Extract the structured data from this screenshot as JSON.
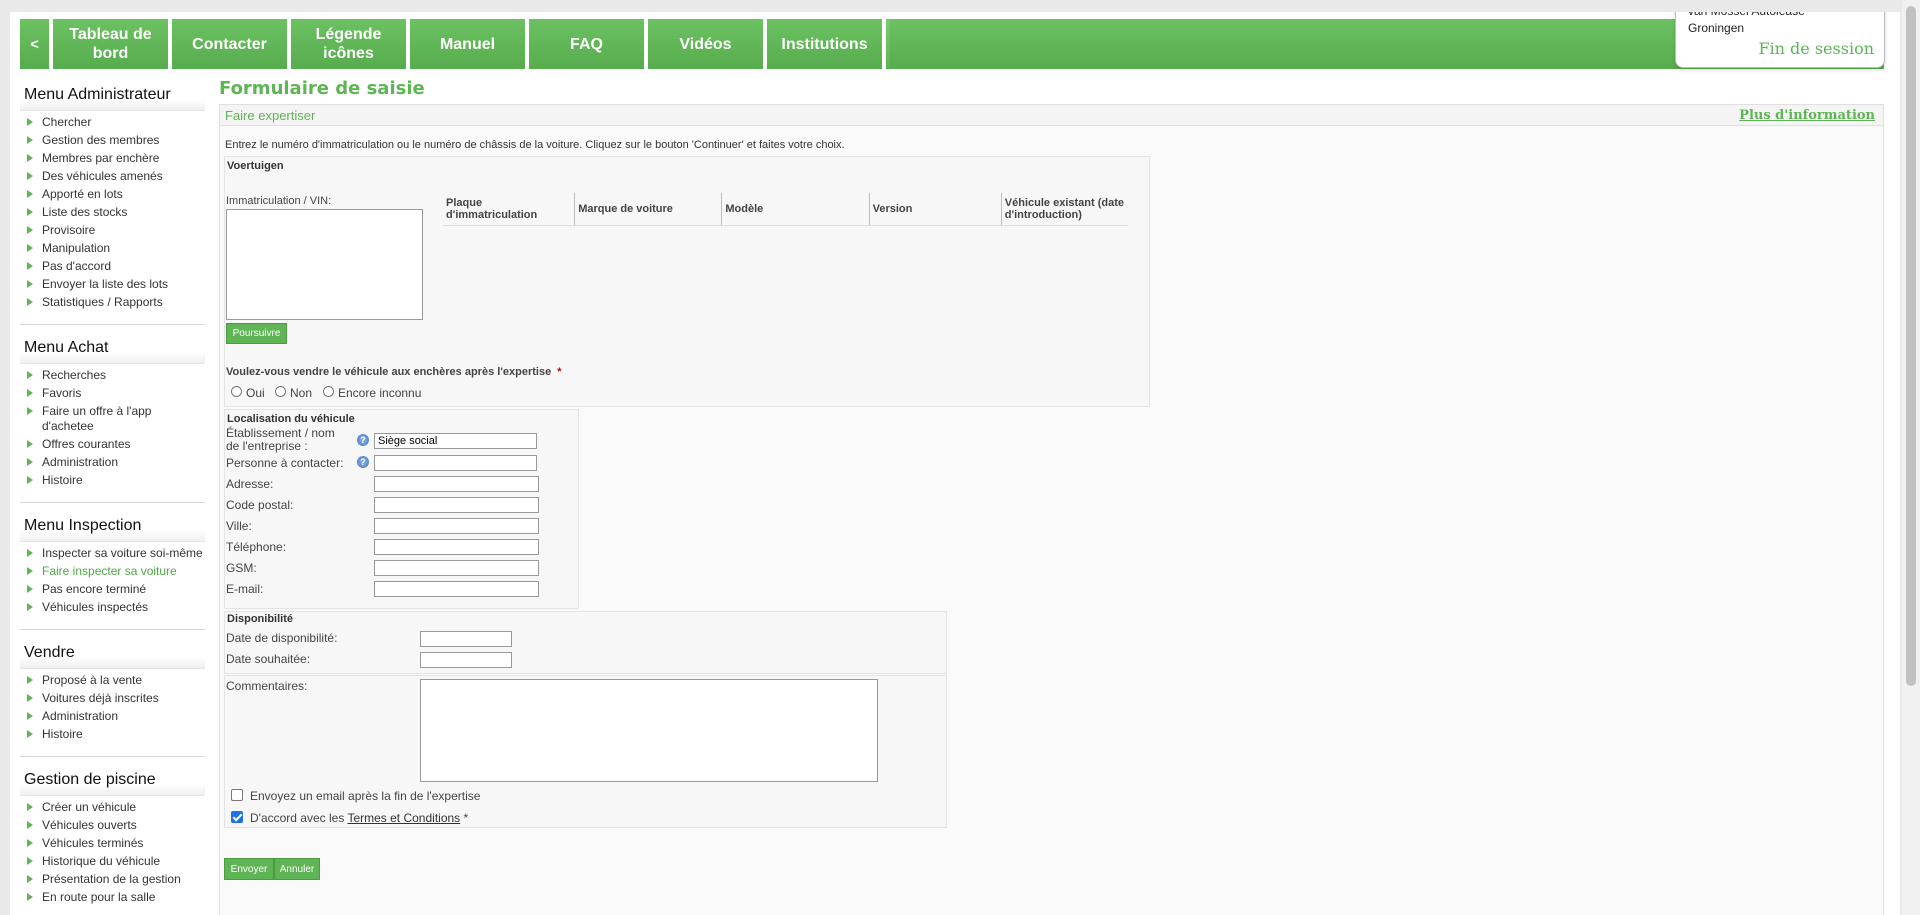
{
  "nav": {
    "back": "<",
    "items": [
      "Tableau de bord",
      "Contacter",
      "Légende icônes",
      "Manuel",
      "FAQ",
      "Vidéos",
      "Institutions"
    ]
  },
  "session": {
    "company_line1": "van Mossel Autolease",
    "company_line2": "Groningen",
    "logout": "Fin de session"
  },
  "sidebar": {
    "menus": [
      {
        "title": "Menu Administrateur",
        "items": [
          "Chercher",
          "Gestion des membres",
          "Membres par enchère",
          "Des véhicules amenés",
          "Apporté en lots",
          "Liste des stocks",
          "Provisoire",
          "Manipulation",
          "Pas d'accord",
          "Envoyer la liste des lots",
          "Statistiques / Rapports"
        ]
      },
      {
        "title": "Menu Achat",
        "items": [
          "Recherches",
          "Favoris",
          "Faire un offre à l'app d'achetee",
          "Offres courantes",
          "Administration",
          "Histoire"
        ]
      },
      {
        "title": "Menu Inspection",
        "items": [
          "Inspecter sa voiture soi-même",
          "Faire inspecter sa voiture",
          "Pas encore terminé",
          "Véhicules inspectés"
        ]
      },
      {
        "title": "Vendre",
        "items": [
          "Proposé à la vente",
          "Voitures déjà inscrites",
          "Administration",
          "Histoire"
        ]
      },
      {
        "title": "Gestion de piscine",
        "items": [
          "Créer un véhicule",
          "Véhicules ouverts",
          "Véhicules terminés",
          "Historique du véhicule",
          "Présentation de la gestion",
          "En route pour la salle"
        ]
      }
    ]
  },
  "main": {
    "title": "Formulaire de saisie",
    "panel_title": "Faire expertiser",
    "more_info": "Plus d'information",
    "intro": "Entrez le numéro d'immatriculation ou le numéro de châssis de la voiture. Cliquez sur le bouton 'Continuer' et faites votre choix.",
    "vehicles": {
      "legend": "Voertuigen",
      "vin_label": "Immatriculation / VIN:",
      "vin_value": "",
      "continue_btn": "Poursuivre",
      "columns": [
        "Plaque d'immatriculation",
        "Marque de voiture",
        "Modèle",
        "Version",
        "Véhicule existant (date d'introduction)"
      ],
      "question": "Voulez-vous vendre le véhicule aux enchères après l'expertise",
      "required_mark": "*",
      "options": [
        "Oui",
        "Non",
        "Encore inconnu"
      ]
    },
    "location": {
      "legend": "Localisation du véhicule",
      "fields": [
        {
          "label": "Établissement / nom de l'entreprise :",
          "value": "Siège social"
        },
        {
          "label": "Personne à contacter:",
          "value": ""
        },
        {
          "label": "Adresse:",
          "value": ""
        },
        {
          "label": "Code postal:",
          "value": ""
        },
        {
          "label": "Ville:",
          "value": ""
        },
        {
          "label": "Téléphone:",
          "value": ""
        },
        {
          "label": "GSM:",
          "value": ""
        },
        {
          "label": "E-mail:",
          "value": ""
        }
      ]
    },
    "availability": {
      "legend": "Disponibilité",
      "date_available_label": "Date de disponibilité:",
      "date_desired_label": "Date souhaitée:"
    },
    "comments": {
      "label": "Commentaires:",
      "email_after": "Envoyez un email après la fin de l'expertise",
      "agree_prefix": "D'accord avec les ",
      "agree_link": "Termes et Conditions",
      "agree_suffix": " *",
      "email_checked": false,
      "agree_checked": true
    },
    "send_btn": "Envoyer",
    "cancel_btn": "Annuler"
  }
}
